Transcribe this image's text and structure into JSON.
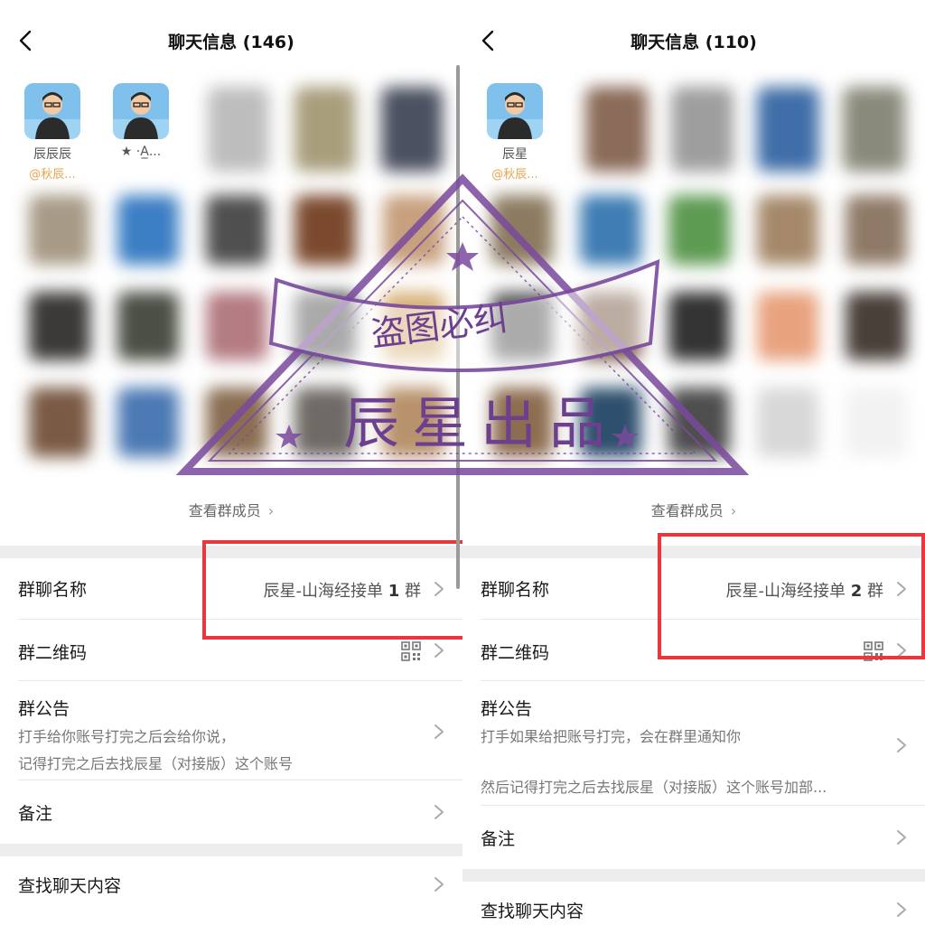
{
  "left": {
    "title": "聊天信息 (146)",
    "members": [
      {
        "name": "辰辰辰",
        "sub": "@秋辰..."
      },
      {
        "name": "★ ·A̲...",
        "sub": ""
      }
    ],
    "view_members": "查看群成员",
    "group_name_label": "群聊名称",
    "group_name_value_prefix": "辰星-山海经接单",
    "group_name_value_num": "1",
    "group_name_value_suffix": "群",
    "qr_label": "群二维码",
    "notice_label": "群公告",
    "notice_line1": "打手给你账号打完之后会给你说，",
    "notice_line2": "记得打完之后去找辰星（对接版）这个账号",
    "remark_label": "备注",
    "search_label": "查找聊天内容"
  },
  "right": {
    "title": "聊天信息 (110)",
    "members": [
      {
        "name": "辰星",
        "sub": "@秋辰..."
      }
    ],
    "view_members": "查看群成员",
    "group_name_label": "群聊名称",
    "group_name_value_prefix": "辰星-山海经接单",
    "group_name_value_num": "2",
    "group_name_value_suffix": "群",
    "qr_label": "群二维码",
    "notice_label": "群公告",
    "notice_line1": "打手如果给把账号打完，会在群里通知你",
    "notice_line2": "然后记得打完之后去找辰星（对接版）这个账号加部...",
    "remark_label": "备注",
    "search_label": "查找聊天内容"
  },
  "watermark": {
    "line1": "盗图必纠",
    "line2": "辰星出品"
  },
  "colors": {
    "highlight_box": "#e8383d",
    "watermark": "#6c3f8f",
    "mention": "#e8a34a"
  },
  "icons": {
    "back": "chevron-left-icon",
    "row_arrow": "chevron-right-icon",
    "qr": "qr-code-icon"
  }
}
